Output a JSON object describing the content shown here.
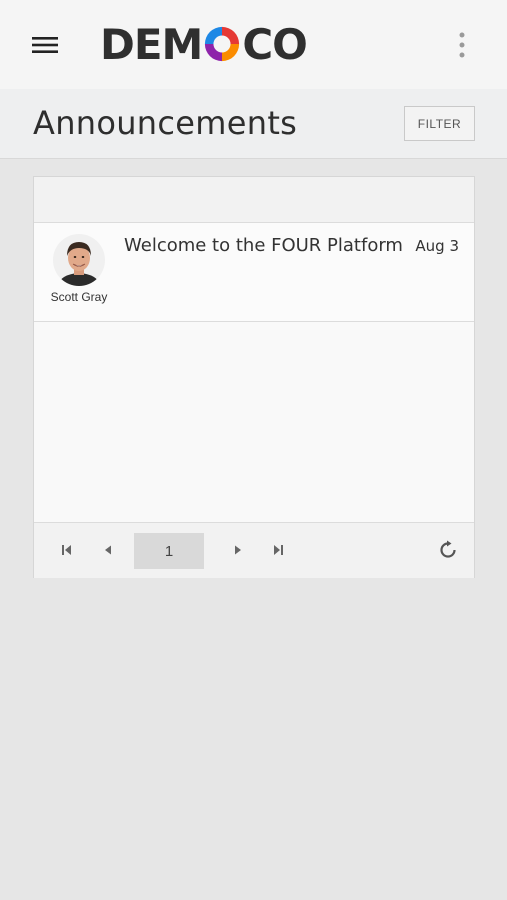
{
  "header": {
    "menu_icon": "hamburger-icon",
    "logo": {
      "text_left": "DEM",
      "text_right": "CO",
      "full_text": "DEMOCO",
      "colors": [
        "#e53935",
        "#fb8c00",
        "#8e24aa",
        "#1e88e5"
      ]
    },
    "more_icon": "kebab-icon"
  },
  "page": {
    "title": "Announcements",
    "filter_label": "FILTER"
  },
  "announcements": [
    {
      "author": "Scott Gray",
      "title": "Welcome to the FOUR Platform",
      "date": "Aug 3"
    }
  ],
  "pager": {
    "current_page": "1",
    "first_icon": "first-page-icon",
    "prev_icon": "prev-page-icon",
    "next_icon": "next-page-icon",
    "last_icon": "last-page-icon",
    "refresh_icon": "refresh-icon"
  }
}
